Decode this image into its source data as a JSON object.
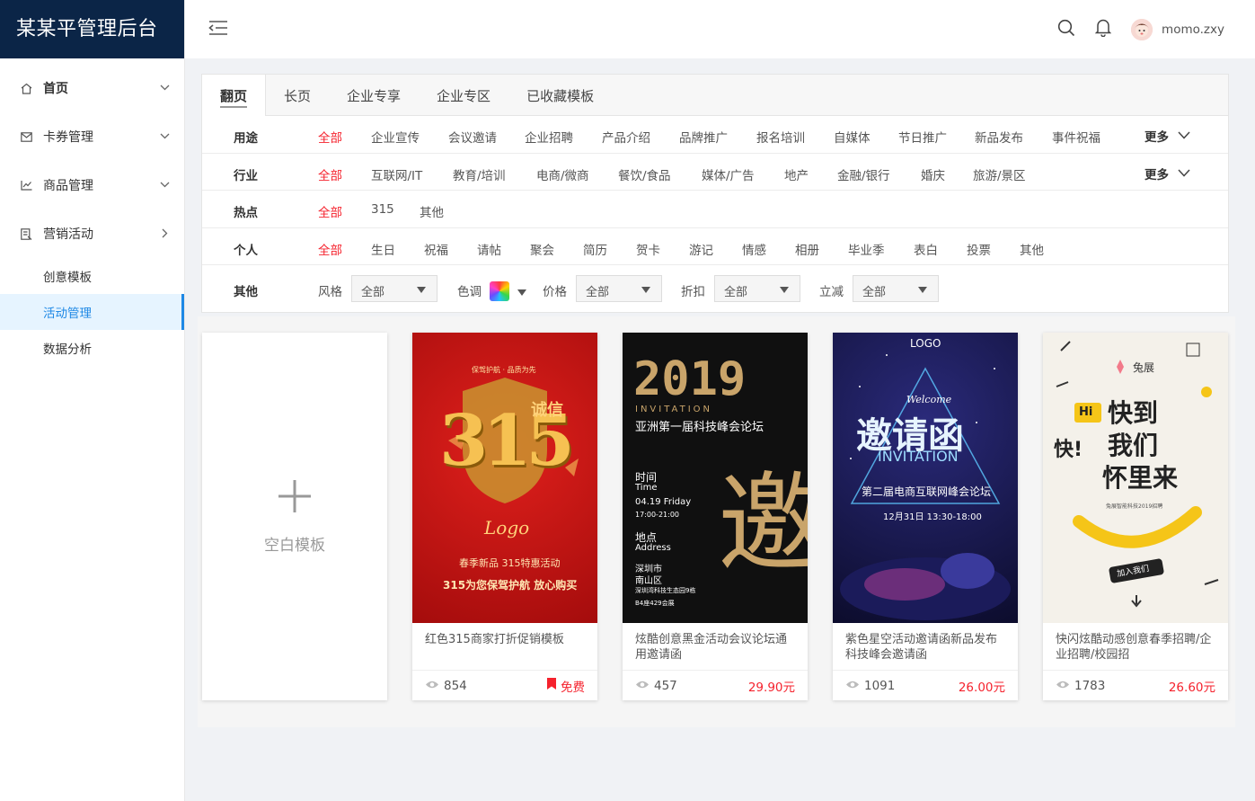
{
  "app": {
    "title": "某某平管理后台"
  },
  "user": {
    "name": "momo.zxy"
  },
  "sidebar": {
    "items": [
      {
        "label": "首页"
      },
      {
        "label": "卡券管理"
      },
      {
        "label": "商品管理"
      },
      {
        "label": "营销活动"
      }
    ],
    "subitems": [
      {
        "label": "创意模板"
      },
      {
        "label": "活动管理"
      },
      {
        "label": "数据分析"
      }
    ]
  },
  "tabs": [
    "翻页",
    "长页",
    "企业专享",
    "企业专区",
    "已收藏模板"
  ],
  "filters": {
    "usage": {
      "label": "用途",
      "options": [
        "全部",
        "企业宣传",
        "会议邀请",
        "企业招聘",
        "产品介绍",
        "品牌推广",
        "报名培训",
        "自媒体",
        "节日推广",
        "新品发布",
        "事件祝福"
      ],
      "more": "更多"
    },
    "industry": {
      "label": "行业",
      "options": [
        "全部",
        "互联网/IT",
        "教育/培训",
        "电商/微商",
        "餐饮/食品",
        "媒体/广告",
        "地产",
        "金融/银行",
        "婚庆",
        "旅游/景区"
      ],
      "more": "更多"
    },
    "hot": {
      "label": "热点",
      "options": [
        "全部",
        "315",
        "其他"
      ]
    },
    "personal": {
      "label": "个人",
      "options": [
        "全部",
        "生日",
        "祝福",
        "请帖",
        "聚会",
        "简历",
        "贺卡",
        "游记",
        "情感",
        "相册",
        "毕业季",
        "表白",
        "投票",
        "其他"
      ]
    },
    "other": {
      "label": "其他",
      "style": {
        "label": "风格",
        "value": "全部"
      },
      "color": {
        "label": "色调"
      },
      "price": {
        "label": "价格",
        "value": "全部"
      },
      "discount": {
        "label": "折扣",
        "value": "全部"
      },
      "reduce": {
        "label": "立减",
        "value": "全部"
      }
    }
  },
  "blank": {
    "label": "空白模板"
  },
  "cards": [
    {
      "title": "红色315商家打折促销模板",
      "views": "854",
      "price": "免费",
      "free": true,
      "thumb": {
        "brand": "诚信",
        "number": "315",
        "logo": "Logo",
        "line1": "春季新品 315特惠活动",
        "line2": "315为您保驾护航 放心购买"
      }
    },
    {
      "title": "炫酷创意黑金活动会议论坛通用邀请函",
      "views": "457",
      "price": "29.90元",
      "free": false,
      "thumb": {
        "year": "2019",
        "sub": "INVITATION",
        "head": "亚洲第一届科技峰会论坛",
        "time_cn": "时间",
        "time_en": "Time",
        "date": "04.19 Friday",
        "hours": "17:00-21:00",
        "place_cn": "地点",
        "place_en": "Address",
        "city": "深圳市",
        "district": "南山区",
        "addr1": "深圳湾科技生态园9栋",
        "addr2": "B4座429会展",
        "big": "邀"
      }
    },
    {
      "title": "紫色星空活动邀请函新品发布科技峰会邀请函",
      "views": "1091",
      "price": "26.00元",
      "free": false,
      "thumb": {
        "logo": "LOGO",
        "welcome": "Welcome",
        "big": "邀请函",
        "sub": "INVITATION",
        "head": "第二届电商互联网峰会论坛",
        "date": "12月31日  13:30-18:00"
      }
    },
    {
      "title": "快闪炫酷动感创意春季招聘/企业招聘/校园招",
      "views": "1783",
      "price": "26.60元",
      "free": false,
      "thumb": {
        "brand": "兔展",
        "hi": "Hi",
        "line1": "快到",
        "line2": "我们",
        "line3": "怀里来",
        "exclaim": "快!",
        "small": "兔展智能科技2019招聘",
        "badge": "加入我们"
      }
    }
  ]
}
